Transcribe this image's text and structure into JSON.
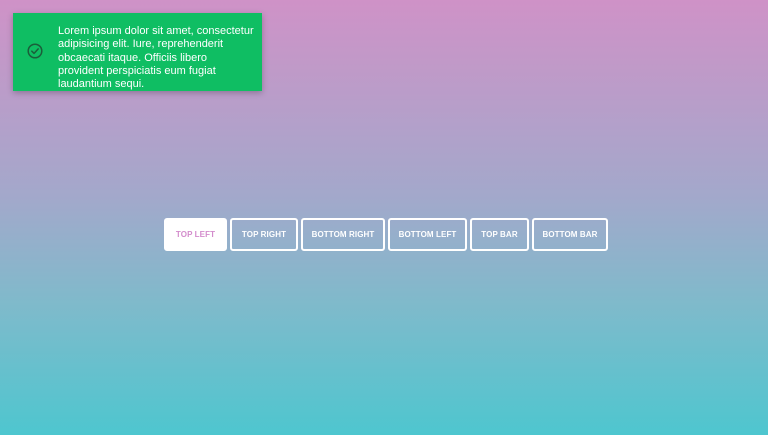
{
  "toast": {
    "message": "Lorem ipsum dolor sit amet, consectetur adipisicing elit. Iure, reprehenderit obcaecati itaque. Officiis libero provident perspiciatis eum fugiat laudantium sequi.",
    "icon": "check-circle-icon",
    "background_color": "#0fbe63"
  },
  "buttons": {
    "top_left": "TOP LEFT",
    "top_right": "TOP RIGHT",
    "bottom_right": "BOTTOM RIGHT",
    "bottom_left": "BOTTOM LEFT",
    "top_bar": "TOP BAR",
    "bottom_bar": "BOTTOM BAR"
  },
  "theme": {
    "gradient_top": "#cf92c7",
    "gradient_bottom": "#4ec6cf",
    "active_text_color": "#d38ccc"
  }
}
